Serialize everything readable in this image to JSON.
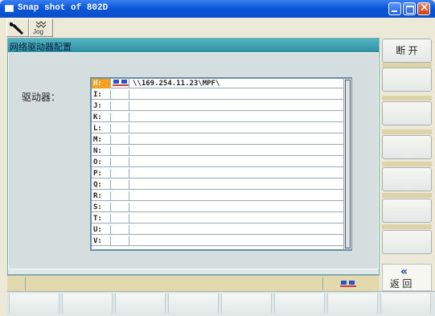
{
  "window": {
    "title": "Snap shot of 802D"
  },
  "toolbar": {
    "jog_label": "Jog"
  },
  "panel": {
    "header": "网络驱动器配置",
    "drive_label": "驱动器："
  },
  "drives": [
    {
      "letter": "H:",
      "path": "\\\\169.254.11.23\\MPF\\",
      "icon": "network-drive-icon",
      "selected": true
    },
    {
      "letter": "I:",
      "path": ""
    },
    {
      "letter": "J:",
      "path": ""
    },
    {
      "letter": "K:",
      "path": ""
    },
    {
      "letter": "L:",
      "path": ""
    },
    {
      "letter": "M:",
      "path": ""
    },
    {
      "letter": "N:",
      "path": ""
    },
    {
      "letter": "O:",
      "path": ""
    },
    {
      "letter": "P:",
      "path": ""
    },
    {
      "letter": "Q:",
      "path": ""
    },
    {
      "letter": "R:",
      "path": ""
    },
    {
      "letter": "S:",
      "path": ""
    },
    {
      "letter": "T:",
      "path": ""
    },
    {
      "letter": "U:",
      "path": ""
    },
    {
      "letter": "V:",
      "path": ""
    }
  ],
  "softkeys": {
    "disconnect": "断 开",
    "back": "返 回",
    "back_arrow": "«"
  },
  "colors": {
    "header_teal": "#3ea2b3",
    "selection_orange": "#f4a020",
    "status_tan": "#e3d9af"
  }
}
